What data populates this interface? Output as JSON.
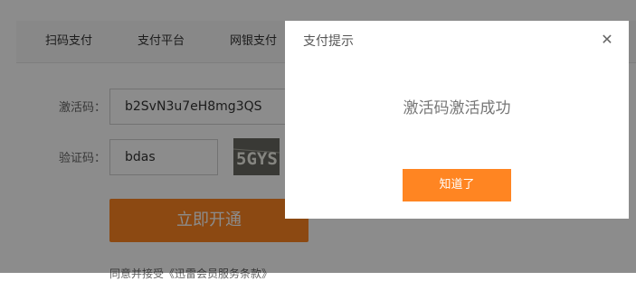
{
  "tabs": {
    "items": [
      {
        "label": "扫码支付"
      },
      {
        "label": "支付平台"
      },
      {
        "label": "网银支付"
      }
    ]
  },
  "form": {
    "code_label": "激活码：",
    "code_value": "b2SvN3u7eH8mg3QS",
    "verify_label": "验证码：",
    "verify_value": "bdas",
    "captcha_text": "5GYS",
    "open_button": "立即开通",
    "agreement": "同意并接受《迅雷会员服务条款》"
  },
  "dialog": {
    "title": "支付提示",
    "close_icon": "close-icon",
    "message": "激活码激活成功",
    "ok_button": "知道了"
  },
  "colors": {
    "accent": "#ff8522",
    "mask": "rgba(0,0,0,0.45)"
  }
}
